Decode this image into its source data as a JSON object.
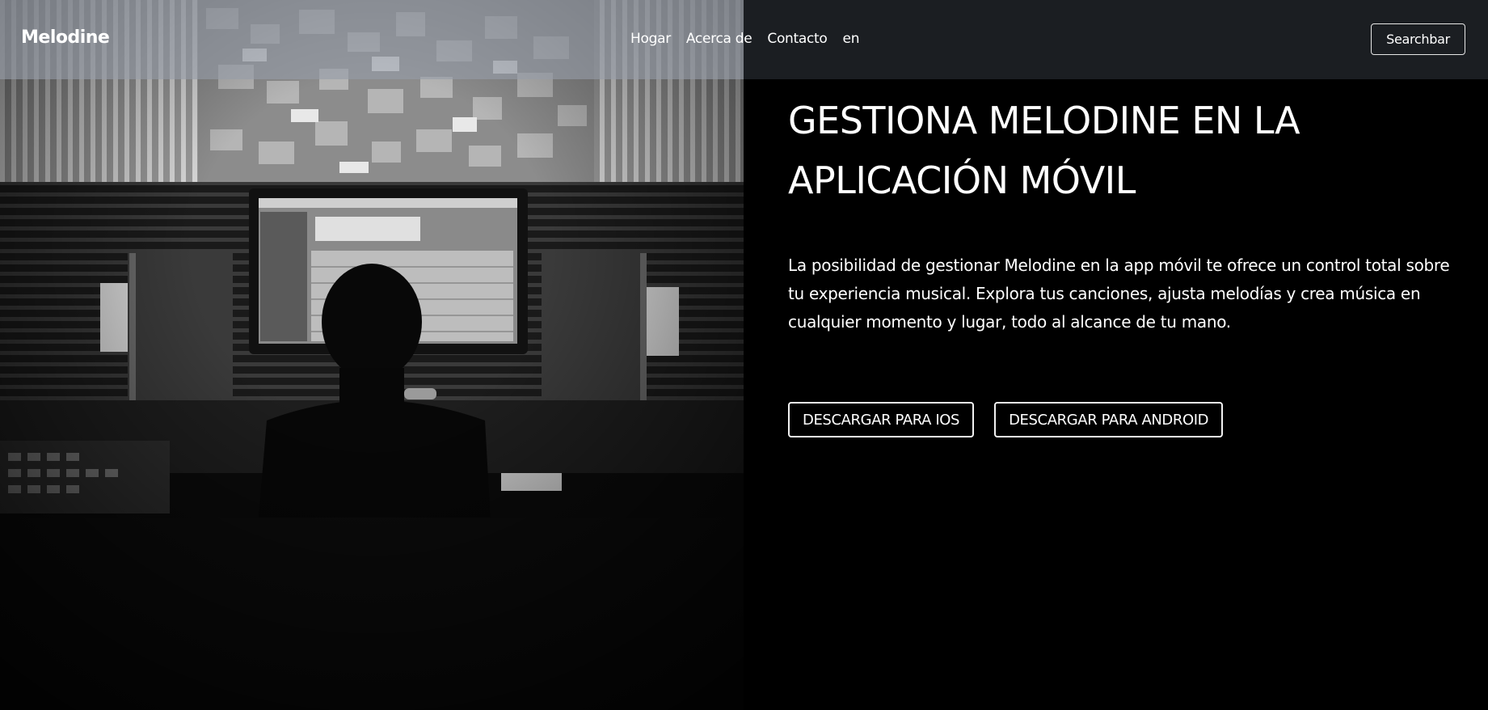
{
  "navbar": {
    "brand": "Melodine",
    "links": [
      "Hogar",
      "Acerca de",
      "Contacto",
      "en"
    ],
    "search_label": "Searchbar"
  },
  "hero": {
    "title": "GESTIONA MELODINE EN LA APLICACIÓN MÓVIL",
    "description": "La posibilidad de gestionar Melodine en la app móvil te ofrece un control total sobre tu experiencia musical. Explora tus canciones, ajusta melodías y crea música en cualquier momento y lugar, todo al alcance de tu mano.",
    "buttons": {
      "ios": "DESCARGAR PARA IOS",
      "android": "DESCARGAR PARA ANDROID"
    }
  },
  "colors": {
    "background": "#000000",
    "navbar_dark": "#1b1e22",
    "text": "#ffffff"
  }
}
